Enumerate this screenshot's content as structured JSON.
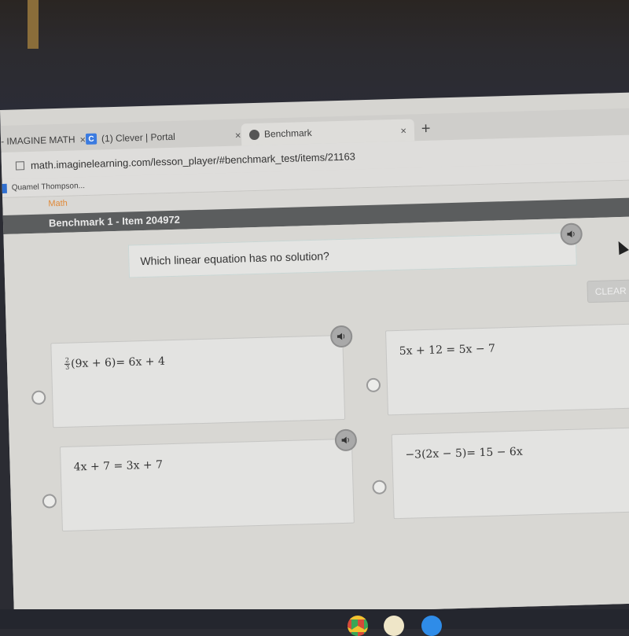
{
  "browser": {
    "tabs": [
      {
        "label": "- IMAGINE MATH",
        "icon": "imagine-math-icon",
        "active": false
      },
      {
        "label": "(1) Clever | Portal",
        "icon": "clever-icon",
        "active": false
      },
      {
        "label": "Benchmark",
        "icon": "globe-icon",
        "active": true
      }
    ],
    "close_glyph": "×",
    "new_tab_glyph": "+",
    "url": "math.imaginelearning.com/lesson_player/#benchmark_test/items/21163",
    "bookmark": "Quamel Thompson..."
  },
  "app": {
    "subject": "Math",
    "item_title": "Benchmark 1 - Item 204972",
    "question": "Which linear equation has no solution?",
    "clear_label": "CLEAR",
    "choices": [
      {
        "id": "A",
        "frac_num": "2",
        "frac_den": "3",
        "equation": "(9x + 6)= 6x + 4",
        "has_audio": true,
        "selected": false
      },
      {
        "id": "B",
        "equation": "5x + 12 = 5x − 7",
        "has_audio": false,
        "selected": false
      },
      {
        "id": "C",
        "equation": "4x + 7 = 3x + 7",
        "has_audio": true,
        "selected": false
      },
      {
        "id": "D",
        "equation": "−3(2x − 5)= 15 − 6x",
        "has_audio": false,
        "selected": false
      }
    ]
  },
  "shelf": {
    "apps": [
      "chrome-icon",
      "google-classroom-icon",
      "zoom-icon"
    ]
  },
  "colors": {
    "item_bar": "#5b5d5e",
    "subject_accent": "#e08a3a",
    "clever_brand": "#3b7be0"
  }
}
